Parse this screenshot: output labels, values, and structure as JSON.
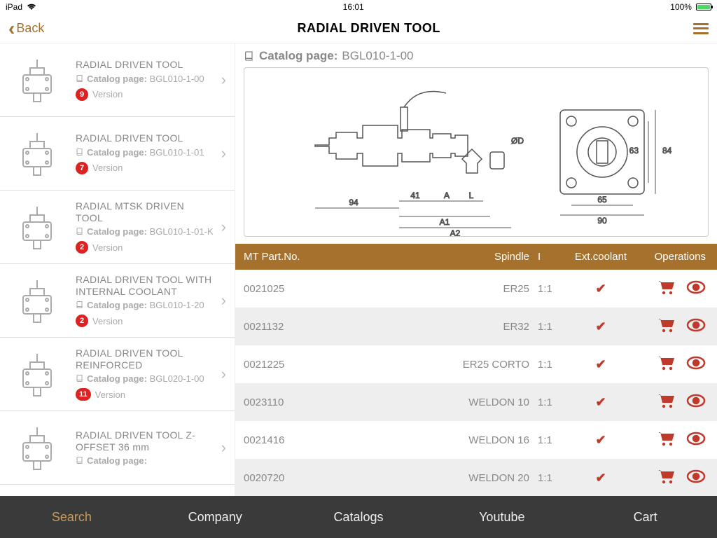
{
  "status": {
    "device": "iPad",
    "time": "16:01",
    "battery": "100%"
  },
  "header": {
    "back": "Back",
    "title": "RADIAL DRIVEN TOOL"
  },
  "catalog_page_label": "Catalog page:",
  "version_label": "Version",
  "sidebar": [
    {
      "name": "RADIAL DRIVEN TOOL",
      "page": "BGL010-1-00",
      "versions": "9"
    },
    {
      "name": "RADIAL DRIVEN TOOL",
      "page": "BGL010-1-01",
      "versions": "7"
    },
    {
      "name": "RADIAL MTSK DRIVEN TOOL",
      "page": "BGL010-1-01-K",
      "versions": "2"
    },
    {
      "name": "RADIAL DRIVEN TOOL WITH INTERNAL COOLANT",
      "page": "BGL010-1-20",
      "versions": "2"
    },
    {
      "name": "RADIAL DRIVEN TOOL REINFORCED",
      "page": "BGL020-1-00",
      "versions": "11"
    },
    {
      "name": "RADIAL DRIVEN TOOL Z-OFFSET 36 mm",
      "page": "",
      "versions": ""
    }
  ],
  "main": {
    "catalog_page": "BGL010-1-00",
    "columns": {
      "part": "MT Part.No.",
      "spindle": "Spindle",
      "i": "I",
      "ext": "Ext.coolant",
      "ops": "Operations"
    },
    "rows": [
      {
        "part": "0021025",
        "spindle": "ER25",
        "i": "1:1",
        "ext": true
      },
      {
        "part": "0021132",
        "spindle": "ER32",
        "i": "1:1",
        "ext": true
      },
      {
        "part": "0021225",
        "spindle": "ER25 CORTO",
        "i": "1:1",
        "ext": true
      },
      {
        "part": "0023110",
        "spindle": "WELDON 10",
        "i": "1:1",
        "ext": true
      },
      {
        "part": "0021416",
        "spindle": "WELDON 16",
        "i": "1:1",
        "ext": true
      },
      {
        "part": "0020720",
        "spindle": "WELDON 20",
        "i": "1:1",
        "ext": true
      }
    ]
  },
  "tabs": {
    "search": "Search",
    "company": "Company",
    "catalogs": "Catalogs",
    "youtube": "Youtube",
    "cart": "Cart"
  },
  "diagram_dims": {
    "d1": "94",
    "d2": "41",
    "a": "A",
    "l": "L",
    "a1": "A1",
    "a2": "A2",
    "dia": "ØD",
    "h1": "84",
    "h2": "63",
    "w1": "65",
    "w2": "90"
  }
}
